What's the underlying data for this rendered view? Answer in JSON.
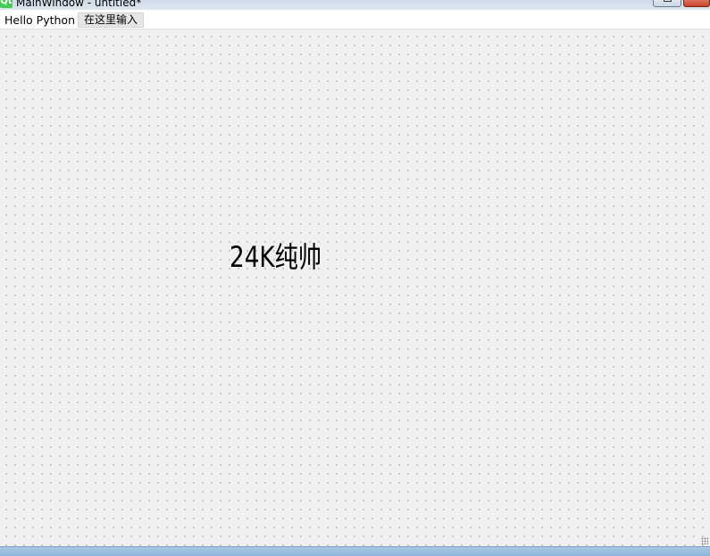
{
  "window": {
    "title": "MainWindow - untitled*",
    "logo_text": "Qt"
  },
  "menubar": {
    "items": [
      {
        "label": "Hello Python"
      },
      {
        "label": "在这里输入"
      }
    ]
  },
  "form": {
    "label_text": "24K纯帅"
  },
  "icons": {
    "app": "qt-logo-icon",
    "maximize": "maximize-icon",
    "close": "close-icon",
    "resize": "size-grip-icon"
  },
  "colors": {
    "qt_green": "#41cd52",
    "close_red": "#c8432a",
    "titlebar": "#cfdbe8",
    "statusbar": "#8fb4da"
  }
}
